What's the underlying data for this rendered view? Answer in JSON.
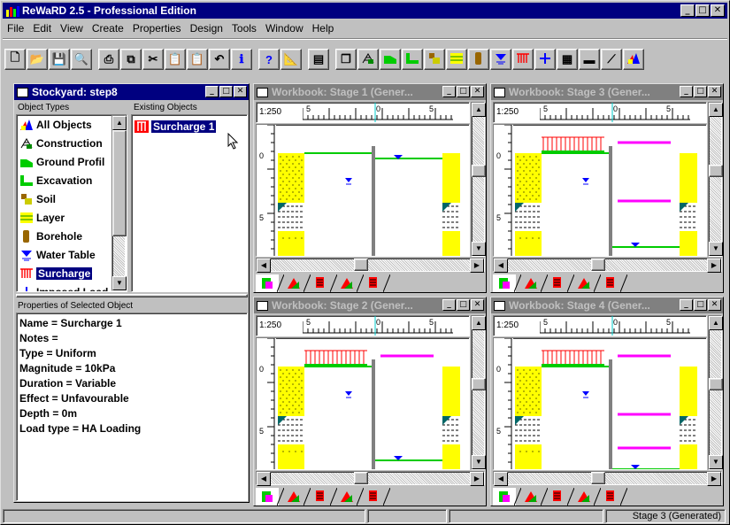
{
  "app": {
    "title": "ReWaRD 2.5 - Professional Edition"
  },
  "menu": [
    "File",
    "Edit",
    "View",
    "Create",
    "Properties",
    "Design",
    "Tools",
    "Window",
    "Help"
  ],
  "toolbar_icons": [
    "new-icon",
    "open-icon",
    "save-icon",
    "print-preview-icon",
    "print-icon",
    "copy-icon",
    "cut-icon",
    "paste-icon",
    "paste-special-icon",
    "undo-icon",
    "info-icon",
    "help-icon",
    "design-icon",
    "report-icon",
    "windows-icon",
    "construction-icon",
    "ground-profile-icon",
    "excavation-icon",
    "soil-icon",
    "layer-icon",
    "borehole-icon",
    "water-table-icon",
    "surcharge-icon",
    "imposed-load-icon",
    "wall-icon",
    "strut-icon",
    "anchor-icon",
    "all-objects-icon"
  ],
  "stockyard": {
    "title": "Stockyard: step8",
    "types_header": "Object Types",
    "existing_header": "Existing Objects",
    "types": [
      {
        "label": "All Objects",
        "icon": "all-objects-icon"
      },
      {
        "label": "Construction",
        "icon": "construction-icon"
      },
      {
        "label": "Ground Profil",
        "icon": "ground-profile-icon"
      },
      {
        "label": "Excavation",
        "icon": "excavation-icon"
      },
      {
        "label": "Soil",
        "icon": "soil-icon"
      },
      {
        "label": "Layer",
        "icon": "layer-icon"
      },
      {
        "label": "Borehole",
        "icon": "borehole-icon"
      },
      {
        "label": "Water Table",
        "icon": "water-table-icon"
      },
      {
        "label": "Surcharge",
        "icon": "surcharge-icon"
      },
      {
        "label": "Imposed Load",
        "icon": "imposed-load-icon"
      }
    ],
    "existing": [
      {
        "label": "Surcharge 1",
        "icon": "surcharge-icon"
      }
    ],
    "props_header": "Properties of Selected Object",
    "properties": [
      "Name = Surcharge 1",
      "Notes =",
      "Type = Uniform",
      "Magnitude = 10kPa",
      "Duration = Variable",
      "Effect = Unfavourable",
      "Depth = 0m",
      "Load type = HA Loading"
    ]
  },
  "workbooks": [
    {
      "title": "Workbook: Stage 1 (Gener...",
      "scale": "1:250",
      "ticks": [
        "5",
        "0",
        "5"
      ],
      "depths": [
        "0",
        "5"
      ],
      "surcharge": false,
      "water_right": 0
    },
    {
      "title": "Workbook: Stage 3 (Gener...",
      "scale": "1:250",
      "ticks": [
        "5",
        "0",
        "5"
      ],
      "depths": [
        "0",
        "5"
      ],
      "surcharge": true,
      "water_right": 2
    },
    {
      "title": "Workbook: Stage 2 (Gener...",
      "scale": "1:250",
      "ticks": [
        "5",
        "0",
        "5"
      ],
      "depths": [
        "0",
        "5"
      ],
      "surcharge": true,
      "water_right": 1
    },
    {
      "title": "Workbook: Stage 4 (Gener...",
      "scale": "1:250",
      "ticks": [
        "5",
        "0",
        "5"
      ],
      "depths": [
        "0",
        "5"
      ],
      "surcharge": true,
      "water_right": 3
    }
  ],
  "status": {
    "right": "Stage 3 (Generated)"
  },
  "colors": {
    "titlebar": "#000080",
    "soil": "#ffff00",
    "water": "#0000ff",
    "surcharge": "#ff0000",
    "strut": "#ff00ff",
    "ground": "#00cc00"
  }
}
